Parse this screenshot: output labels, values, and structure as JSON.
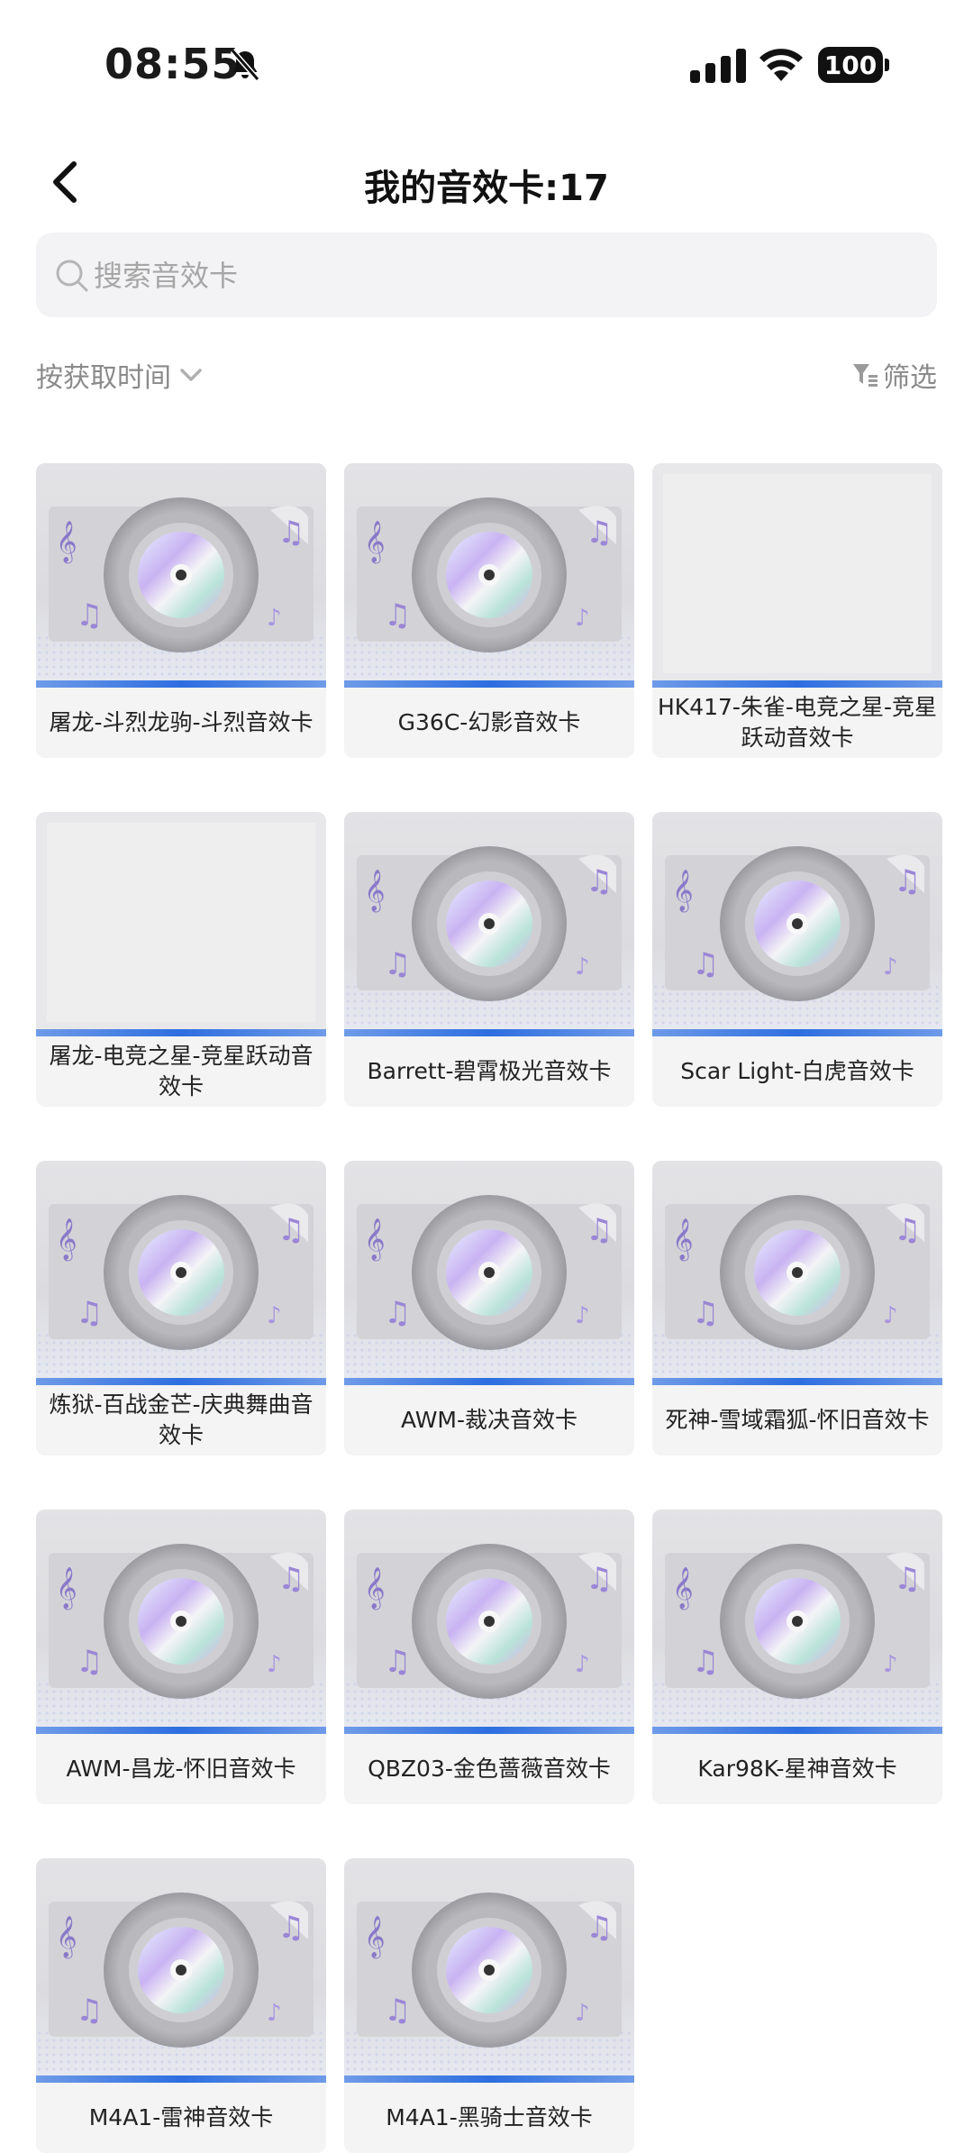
{
  "status_bar": {
    "time": "08:55",
    "battery": "100"
  },
  "header": {
    "title": "我的音效卡:17"
  },
  "search": {
    "placeholder": "搜索音效卡"
  },
  "toolbar": {
    "sort_label": "按获取时间",
    "filter_label": "筛选"
  },
  "cards": [
    {
      "label": "屠龙-斗烈龙驹-斗烈音效卡",
      "thumb": "disc"
    },
    {
      "label": "G36C-幻影音效卡",
      "thumb": "disc"
    },
    {
      "label": "HK417-朱雀-电竞之星-竞星跃动音效卡",
      "thumb": "blank"
    },
    {
      "label": "屠龙-电竞之星-竞星跃动音效卡",
      "thumb": "blank"
    },
    {
      "label": "Barrett-碧霄极光音效卡",
      "thumb": "disc"
    },
    {
      "label": "Scar Light-白虎音效卡",
      "thumb": "disc"
    },
    {
      "label": "炼狱-百战金芒-庆典舞曲音效卡",
      "thumb": "disc"
    },
    {
      "label": "AWM-裁决音效卡",
      "thumb": "disc"
    },
    {
      "label": "死神-雪域霜狐-怀旧音效卡",
      "thumb": "disc"
    },
    {
      "label": "AWM-昌龙-怀旧音效卡",
      "thumb": "disc"
    },
    {
      "label": "QBZ03-金色蔷薇音效卡",
      "thumb": "disc"
    },
    {
      "label": "Kar98K-星神音效卡",
      "thumb": "disc"
    },
    {
      "label": "M4A1-雷神音效卡",
      "thumb": "disc"
    },
    {
      "label": "M4A1-黑骑士音效卡",
      "thumb": "disc"
    }
  ]
}
